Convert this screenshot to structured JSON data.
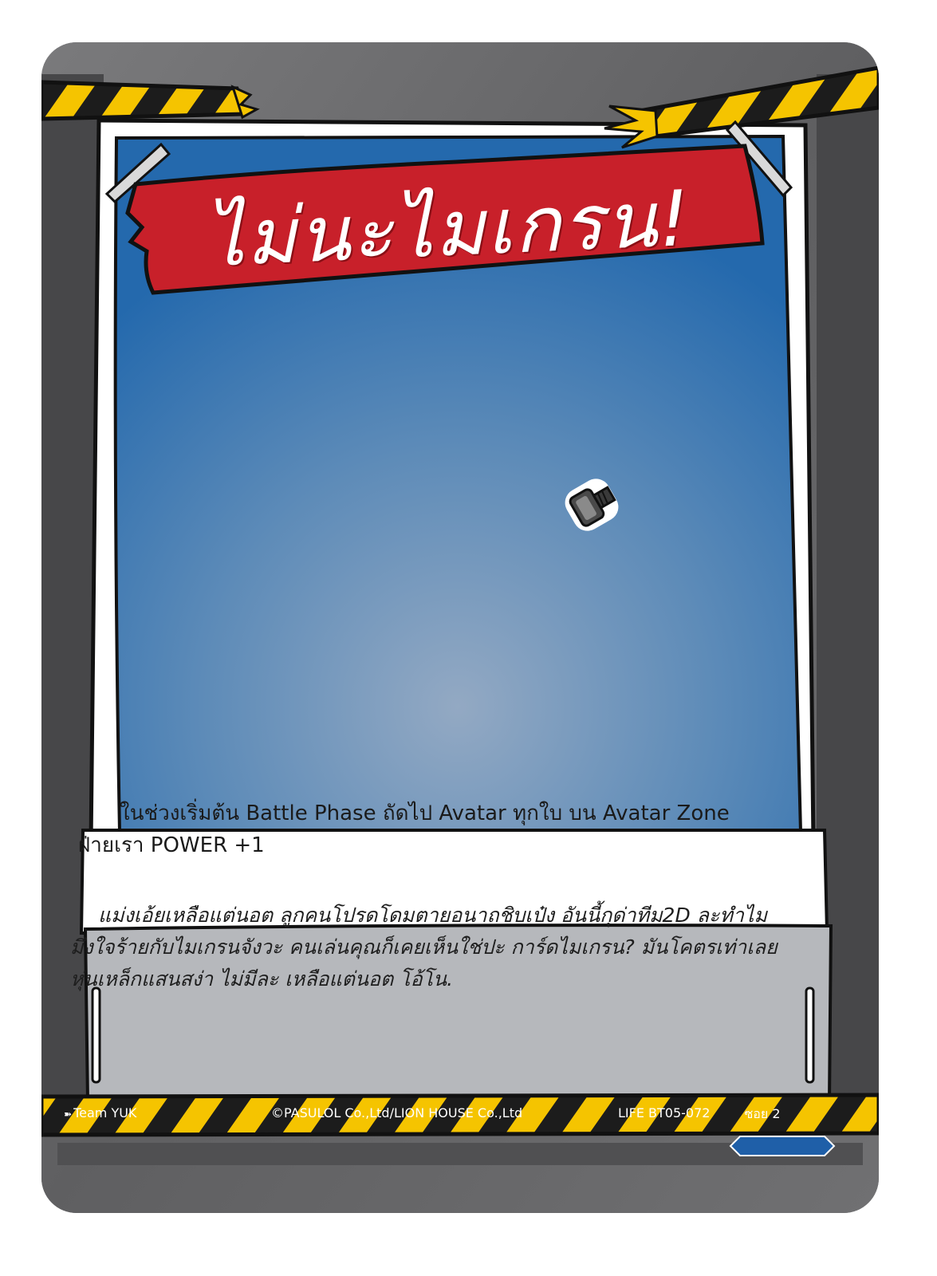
{
  "card": {
    "title": "ไม่นะไมเกรน!",
    "effect_text": "ในช่วงเริ่มต้น Battle Phase ถัดไป Avatar ทุกใบ บน Avatar Zone ฝ่ายเรา POWER +1",
    "flavor_text": "แม่งเอ้ยเหลือแต่นอต ลูกคนโปรดโดมตายอนาถชิบเป๋ง อันนี้กุด่าทีม2D ละทำไมมึงใจร้ายกับไมเกรนจังวะ คนเล่นคุณก็เคยเห็นใช่ปะ การ์ดไมเกรน? มันโคตรเท่าเลยหุ่นเหล็กแสนสง่า ไม่มีละ เหลือแต่นอต โอ้โน.",
    "artwork_icon": "bolt-icon"
  },
  "footer": {
    "team_icon": "arrow-icon",
    "team": "Team YUK",
    "copyright": "©PASULOL Co.,Ltd/LION HOUSE Co.,Ltd",
    "code": "LIFE BT05-072",
    "badge": "ซอย 2"
  },
  "colors": {
    "frame": "#6a6a6c",
    "banner": "#c8202a",
    "art_blue": "#2f72b1",
    "hazard_yellow": "#f5c400",
    "badge_blue": "#1f5fa8"
  }
}
